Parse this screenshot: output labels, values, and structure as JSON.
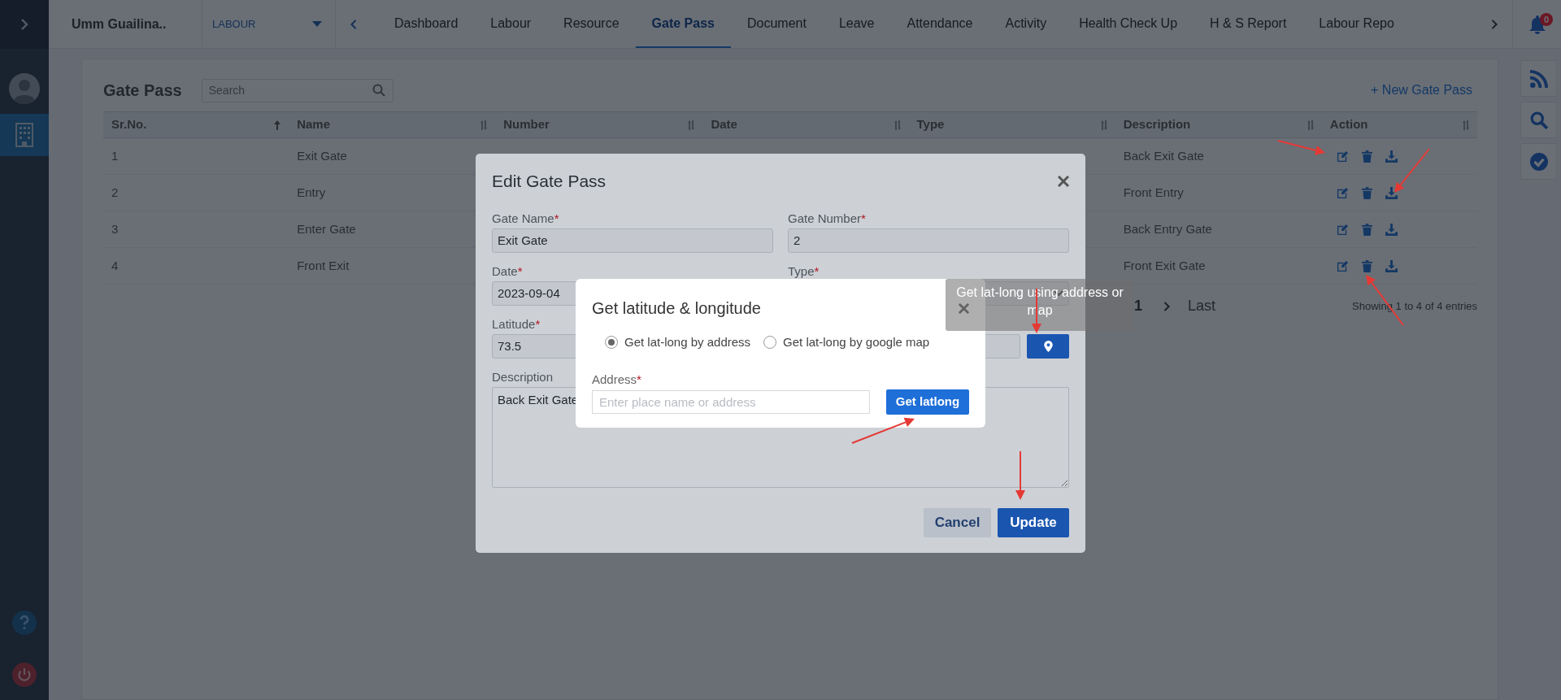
{
  "sidebar": {
    "modules": [
      {
        "selected": true
      }
    ]
  },
  "top_bar": {
    "project": "Umm Guailina..",
    "module_select": "LABOUR",
    "tabs": [
      {
        "label": "Dashboard",
        "selected": false
      },
      {
        "label": "Labour",
        "selected": false
      },
      {
        "label": "Resource",
        "selected": false
      },
      {
        "label": "Gate Pass",
        "selected": true
      },
      {
        "label": "Document",
        "selected": false
      },
      {
        "label": "Leave",
        "selected": false
      },
      {
        "label": "Attendance",
        "selected": false
      },
      {
        "label": "Activity",
        "selected": false
      },
      {
        "label": "Health Check Up",
        "selected": false
      },
      {
        "label": "H & S Report",
        "selected": false
      },
      {
        "label": "Labour Repo",
        "selected": false
      }
    ],
    "notifications": "0"
  },
  "page": {
    "title": "Gate Pass",
    "search": {
      "placeholder": "Search"
    },
    "new_button": "+ New Gate Pass",
    "table": {
      "columns": [
        {
          "label": "Sr.No.",
          "sorted": true
        },
        {
          "label": "Name",
          "sorted": false
        },
        {
          "label": "Number",
          "sorted": false
        },
        {
          "label": "Date",
          "sorted": false
        },
        {
          "label": "Type",
          "sorted": false
        },
        {
          "label": "Description",
          "sorted": false
        },
        {
          "label": "Action",
          "sorted": false
        }
      ],
      "rows": [
        {
          "sr": "1",
          "name": "Exit Gate",
          "description": "Back Exit Gate"
        },
        {
          "sr": "2",
          "name": "Entry",
          "description": "Front Entry"
        },
        {
          "sr": "3",
          "name": "Enter Gate",
          "description": "Back Entry Gate"
        },
        {
          "sr": "4",
          "name": "Front Exit",
          "description": "Front Exit Gate"
        }
      ]
    },
    "pagination": {
      "pages": [
        {
          "label": "1",
          "selected": true
        }
      ],
      "last": "Last",
      "info": "Showing 1 to 4 of 4 entries"
    }
  },
  "edit_modal": {
    "title": "Edit Gate Pass",
    "required_mark": "*",
    "gate_name": {
      "label": "Gate Name",
      "value": "Exit Gate"
    },
    "gate_number": {
      "label": "Gate Number",
      "value": "2"
    },
    "date": {
      "label": "Date",
      "value": "2023-09-04"
    },
    "type": {
      "label": "Type"
    },
    "latitude": {
      "label": "Latitude",
      "value": "73.5"
    },
    "description": {
      "label": "Description",
      "value": "Back Exit Gate"
    },
    "buttons": {
      "cancel": "Cancel",
      "update": "Update"
    }
  },
  "latlong_modal": {
    "title": "Get latitude & longitude",
    "options": [
      {
        "label": "Get lat-long by address",
        "selected": true
      },
      {
        "label": "Get lat-long by google map",
        "selected": false
      }
    ],
    "address": {
      "label": "Address",
      "required_mark": "*",
      "placeholder": "Enter place name or address"
    },
    "button": "Get latlong"
  },
  "tooltip": {
    "text": "Get lat-long using address or map"
  }
}
